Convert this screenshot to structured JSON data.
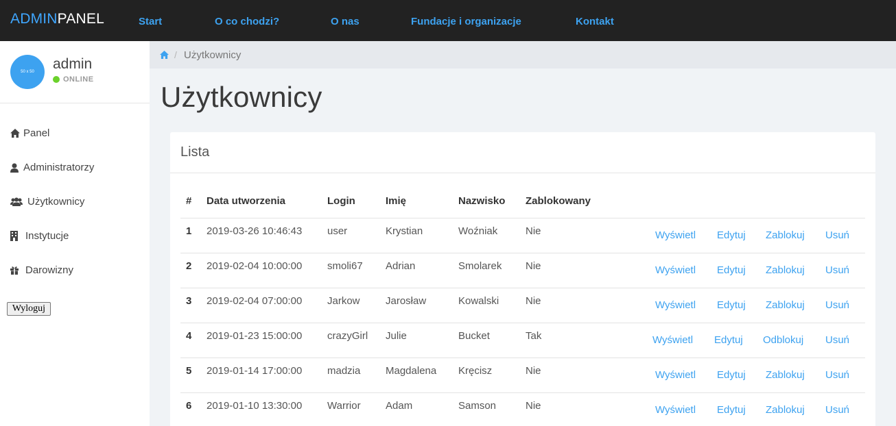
{
  "brand": {
    "part1": "ADMIN",
    "part2": "PANEL"
  },
  "topnav": [
    "Start",
    "O co chodzi?",
    "O nas",
    "Fundacje i organizacje",
    "Kontakt"
  ],
  "sidebar": {
    "avatar_text": "50 x 50",
    "user_name": "admin",
    "status": "ONLINE",
    "items": [
      {
        "label": "Panel",
        "icon": "home-icon"
      },
      {
        "label": "Administratorzy",
        "icon": "user-icon"
      },
      {
        "label": "Użytkownicy",
        "icon": "users-icon"
      },
      {
        "label": "Instytucje",
        "icon": "building-icon"
      },
      {
        "label": "Darowizny",
        "icon": "gift-icon"
      }
    ],
    "logout": "Wyloguj"
  },
  "breadcrumb": {
    "current": "Użytkownicy"
  },
  "page_title": "Użytkownicy",
  "card": {
    "title": "Lista",
    "headers": [
      "#",
      "Data utworzenia",
      "Login",
      "Imię",
      "Nazwisko",
      "Zablokowany"
    ],
    "rows": [
      {
        "num": "1",
        "date": "2019-03-26 10:46:43",
        "login": "user",
        "first": "Krystian",
        "last": "Woźniak",
        "blocked": "Nie",
        "actions": [
          "Wyświetl",
          "Edytuj",
          "Zablokuj",
          "Usuń"
        ]
      },
      {
        "num": "2",
        "date": "2019-02-04 10:00:00",
        "login": "smoli67",
        "first": "Adrian",
        "last": "Smolarek",
        "blocked": "Nie",
        "actions": [
          "Wyświetl",
          "Edytuj",
          "Zablokuj",
          "Usuń"
        ]
      },
      {
        "num": "3",
        "date": "2019-02-04 07:00:00",
        "login": "Jarkow",
        "first": "Jarosław",
        "last": "Kowalski",
        "blocked": "Nie",
        "actions": [
          "Wyświetl",
          "Edytuj",
          "Zablokuj",
          "Usuń"
        ]
      },
      {
        "num": "4",
        "date": "2019-01-23 15:00:00",
        "login": "crazyGirl",
        "first": "Julie",
        "last": "Bucket",
        "blocked": "Tak",
        "actions": [
          "Wyświetl",
          "Edytuj",
          "Odblokuj",
          "Usuń"
        ]
      },
      {
        "num": "5",
        "date": "2019-01-14 17:00:00",
        "login": "madzia",
        "first": "Magdalena",
        "last": "Kręcisz",
        "blocked": "Nie",
        "actions": [
          "Wyświetl",
          "Edytuj",
          "Zablokuj",
          "Usuń"
        ]
      },
      {
        "num": "6",
        "date": "2019-01-10 13:30:00",
        "login": "Warrior",
        "first": "Adam",
        "last": "Samson",
        "blocked": "Nie",
        "actions": [
          "Wyświetl",
          "Edytuj",
          "Zablokuj",
          "Usuń"
        ]
      }
    ]
  },
  "colors": {
    "accent": "#3da2f0",
    "topbar": "#222222",
    "online": "#6bd12b"
  }
}
